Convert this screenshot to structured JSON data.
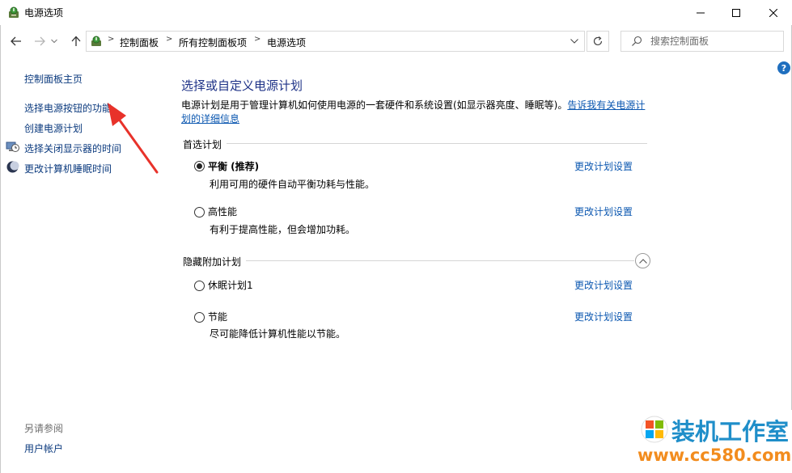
{
  "window": {
    "title": "电源选项"
  },
  "nav": {
    "breadcrumbs": [
      "控制面板",
      "所有控制面板项",
      "电源选项"
    ],
    "separator": ">",
    "search_placeholder": "搜索控制面板"
  },
  "left_pane": {
    "items": [
      {
        "label": "控制面板主页",
        "icon": ""
      },
      {
        "label": "选择电源按钮的功能",
        "icon": ""
      },
      {
        "label": "创建电源计划",
        "icon": ""
      },
      {
        "label": "选择关闭显示器的时间",
        "icon": "monitor-clock-icon"
      },
      {
        "label": "更改计算机睡眠时间",
        "icon": "moon-icon"
      }
    ],
    "see_also_title": "另请参阅",
    "see_also_items": [
      {
        "label": "用户帐户"
      }
    ]
  },
  "main": {
    "title": "选择或自定义电源计划",
    "description": "电源计划是用于管理计算机如何使用电源的一套硬件和系统设置(如显示器亮度、睡眠等)。",
    "description_link_line1": "告诉我有关电源计",
    "description_link_line2": "划的详细信息",
    "preferred_section": "首选计划",
    "hidden_section": "隐藏附加计划",
    "plans": [
      {
        "name": "平衡 (推荐)",
        "description": "利用可用的硬件自动平衡功耗与性能。",
        "link": "更改计划设置",
        "selected": true
      },
      {
        "name": "高性能",
        "description": "有利于提高性能，但会增加功耗。",
        "link": "更改计划设置",
        "selected": false
      },
      {
        "name": "休眠计划1",
        "description": "",
        "link": "更改计划设置",
        "selected": false
      },
      {
        "name": "节能",
        "description": "尽可能降低计算机性能以节能。",
        "link": "更改计划设置",
        "selected": false
      }
    ]
  },
  "watermark": {
    "title": "装机工作室",
    "url": "www.cc580.com"
  },
  "colors": {
    "link": "#0b57b0",
    "heading": "#1e3287",
    "annotation_arrow": "#e8322a",
    "watermark_blue": "#1f8ec9",
    "watermark_orange": "#f28c1e"
  }
}
